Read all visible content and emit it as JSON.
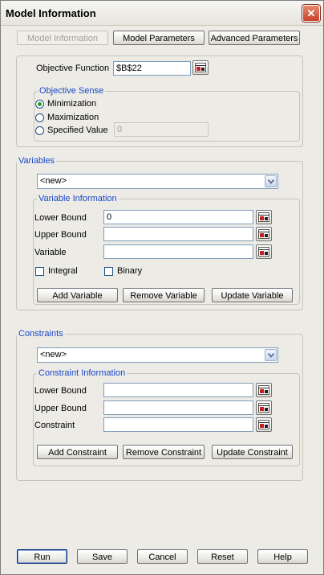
{
  "window": {
    "title": "Model Information",
    "close_glyph": "✕"
  },
  "tabs": {
    "model_information": "Model Information",
    "model_parameters": "Model Parameters",
    "advanced_parameters": "Advanced Parameters"
  },
  "objective": {
    "function_label": "Objective Function",
    "function_value": "$B$22",
    "sense_title": "Objective Sense",
    "minimization": "Minimization",
    "maximization": "Maximization",
    "specified_value": "Specified Value",
    "specified_value_field": "0",
    "selected": "Minimization"
  },
  "variables": {
    "title": "Variables",
    "combo_value": "<new>",
    "info_title": "Variable Information",
    "lower_bound_label": "Lower Bound",
    "lower_bound_value": "0",
    "upper_bound_label": "Upper Bound",
    "upper_bound_value": "",
    "variable_label": "Variable",
    "variable_value": "",
    "integral_label": "Integral",
    "binary_label": "Binary",
    "add_button": "Add Variable",
    "remove_button": "Remove Variable",
    "update_button": "Update Variable"
  },
  "constraints": {
    "title": "Constraints",
    "combo_value": "<new>",
    "info_title": "Constraint Information",
    "lower_bound_label": "Lower Bound",
    "lower_bound_value": "",
    "upper_bound_label": "Upper Bound",
    "upper_bound_value": "",
    "constraint_label": "Constraint",
    "constraint_value": "",
    "add_button": "Add Constraint",
    "remove_button": "Remove Constraint",
    "update_button": "Update Constraint"
  },
  "footer": {
    "run": "Run",
    "save": "Save",
    "cancel": "Cancel",
    "reset": "Reset",
    "help": "Help"
  },
  "icons": {
    "ref_button": "range-select-icon",
    "combo_arrow": "chevron-down-icon"
  }
}
